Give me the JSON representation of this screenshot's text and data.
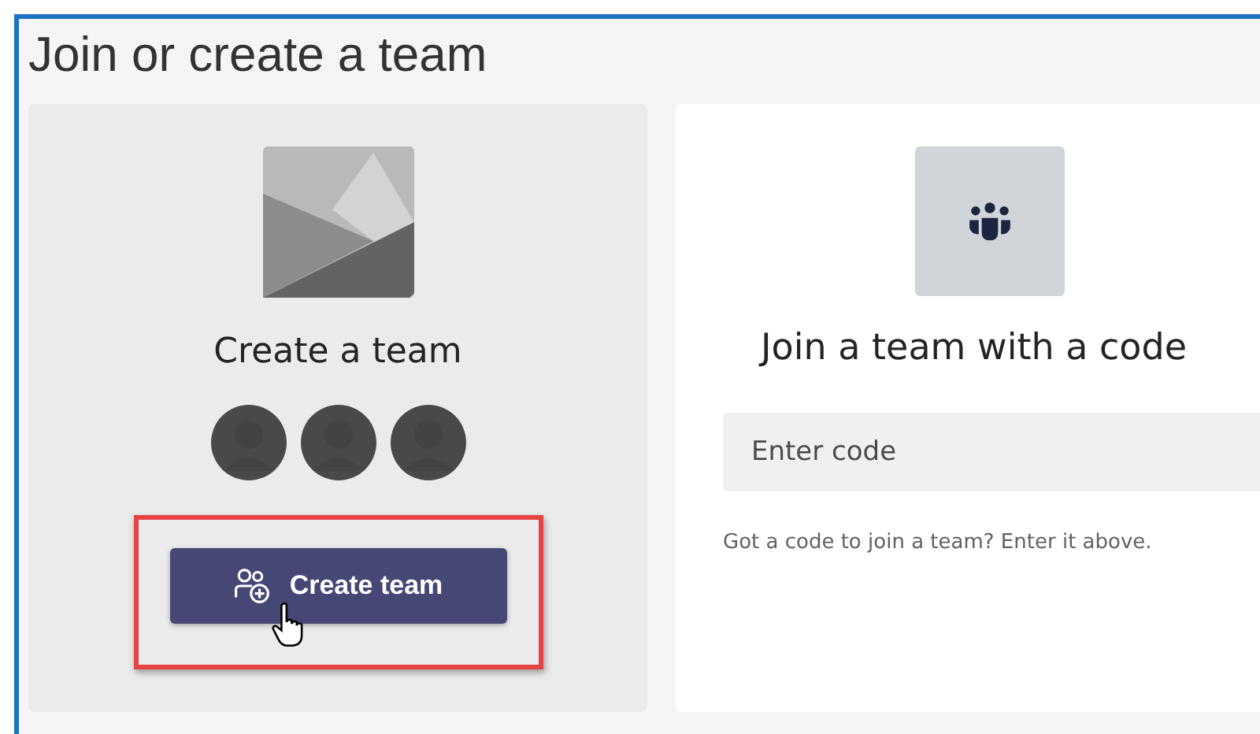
{
  "window": {
    "title": "Join or create a team"
  },
  "create_card": {
    "title": "Create a team",
    "avatars": [
      {
        "kind": "person"
      },
      {
        "kind": "person"
      },
      {
        "kind": "person"
      }
    ],
    "button": {
      "label": "Create team",
      "highlighted": true
    }
  },
  "join_card": {
    "title": "Join a team with a code",
    "field": {
      "placeholder": "Enter code"
    },
    "hint": "Got a code to join a team? Enter it above."
  }
}
